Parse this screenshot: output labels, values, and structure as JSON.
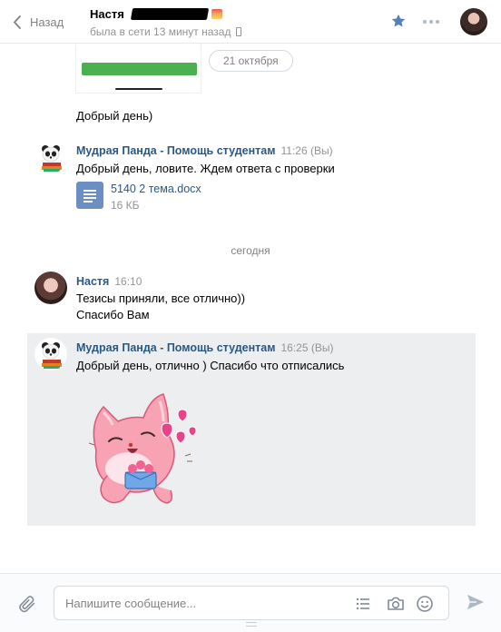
{
  "header": {
    "back_label": "Назад",
    "contact_name": "Настя",
    "status": "была в сети 13 минут назад"
  },
  "messages": {
    "date_pill": "21 октября",
    "msg_greeting": "Добрый день)",
    "panda_name": "Мудрая Панда - Помощь студентам",
    "panda_time_1": "11:26 (Вы)",
    "panda_text_1": "Добрый день, ловите. Ждем ответа с проверки",
    "doc_name": "5140 2 тема.docx",
    "doc_size": "16 КБ",
    "divider_today": "сегодня",
    "nastya_name": "Настя",
    "nastya_time": "16:10",
    "nastya_text_1": "Тезисы приняли, все отлично))",
    "nastya_text_2": "Спасибо Вам",
    "panda_time_2": "16:25 (Вы)",
    "panda_text_2": "Добрый день, отлично ) Спасибо что отписались"
  },
  "composer": {
    "placeholder": "Напишите сообщение..."
  },
  "colors": {
    "link_blue": "#2a5885",
    "accent_blue": "#5181b8",
    "highlight_bg": "#edeef0"
  }
}
